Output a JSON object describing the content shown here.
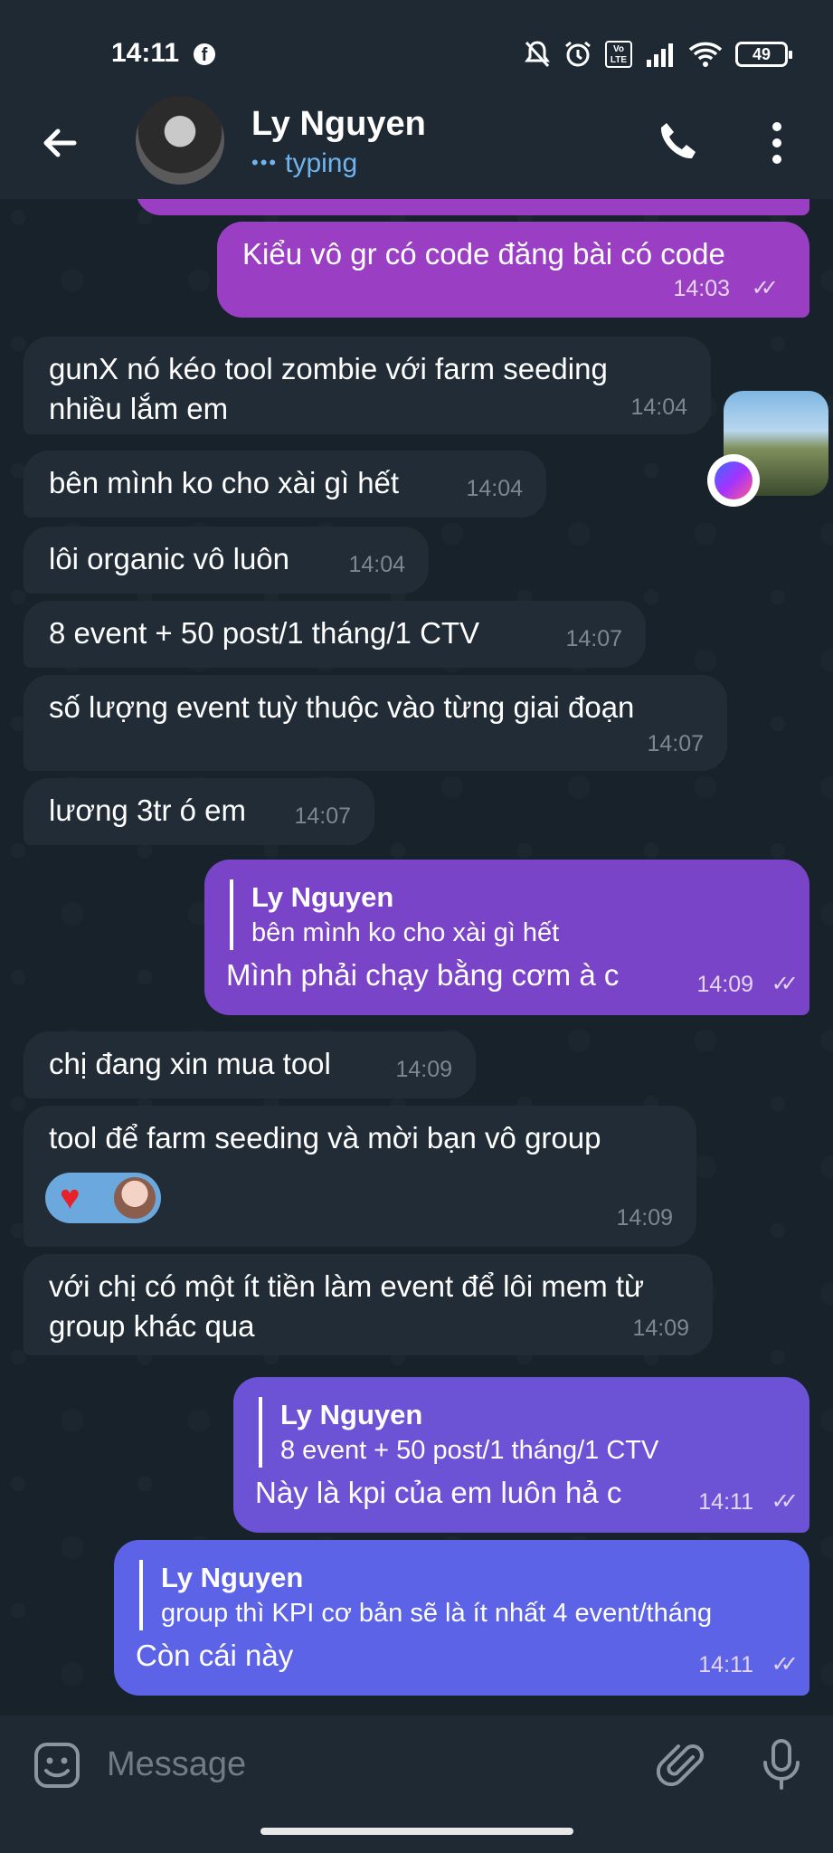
{
  "statusbar": {
    "time": "14:11",
    "battery": "49",
    "volte_label": "Vo LTE"
  },
  "header": {
    "contact_name": "Ly Nguyen",
    "status": "typing"
  },
  "messages": [
    {
      "text": "Kiểu vô gr có code đăng bài có code",
      "time": "14:03"
    },
    {
      "text": "gunX nó kéo tool zombie với farm seeding nhiều lắm em",
      "time": "14:04"
    },
    {
      "text": "bên mình ko cho xài gì hết",
      "time": "14:04"
    },
    {
      "text": "lôi organic vô luôn",
      "time": "14:04"
    },
    {
      "text": "8 event + 50 post/1 tháng/1 CTV",
      "time": "14:07"
    },
    {
      "text": "số lượng event tuỳ thuộc vào từng giai đoạn",
      "time": "14:07"
    },
    {
      "text": "lương 3tr ó em",
      "time": "14:07"
    },
    {
      "reply_name": "Ly Nguyen",
      "reply_text": "bên mình ko cho xài gì hết",
      "text": "Mình phải chạy bằng cơm à c",
      "time": "14:09"
    },
    {
      "text": "chị đang xin mua tool",
      "time": "14:09"
    },
    {
      "text": "tool để farm seeding và mời bạn vô group",
      "time": "14:09"
    },
    {
      "text": "với chị có một ít tiền làm event để lôi mem từ group khác qua",
      "time": "14:09"
    },
    {
      "reply_name": "Ly Nguyen",
      "reply_text": "8 event + 50 post/1 tháng/1 CTV",
      "text": "Này là kpi của em luôn hả c",
      "time": "14:11"
    },
    {
      "reply_name": "Ly Nguyen",
      "reply_text": "group thì KPI cơ bản sẽ là ít nhất 4 event/tháng",
      "text": "Còn cái này",
      "time": "14:11"
    }
  ],
  "input": {
    "placeholder": "Message"
  },
  "colors": {
    "out_bubble_top": "#9a3fc4",
    "out_bubble_mid": "#7a4ad0",
    "out_bubble_bottom": "#5c63e6",
    "in_bubble": "#212c36",
    "header": "#1e2933",
    "typing": "#6fb4ef"
  }
}
